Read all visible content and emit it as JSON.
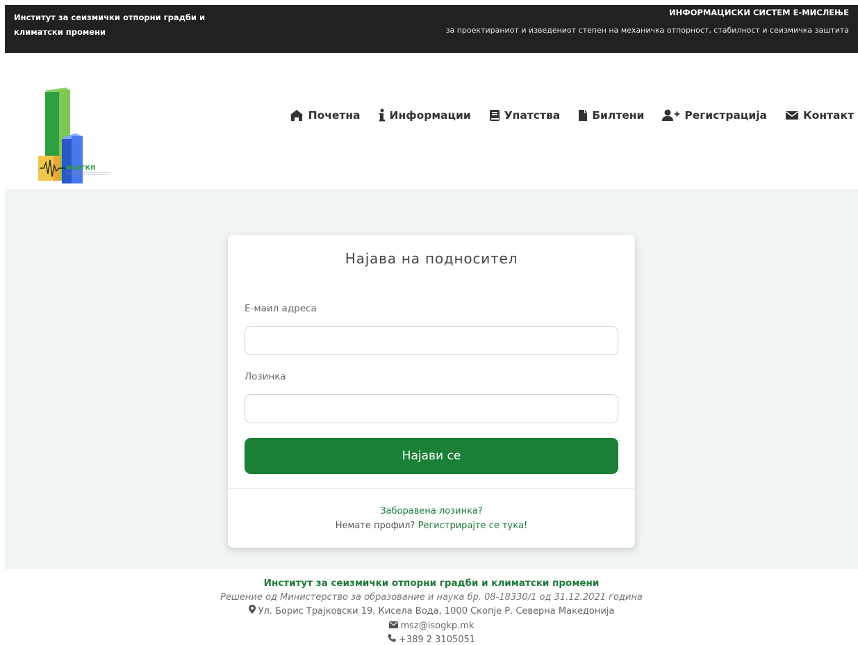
{
  "topbar": {
    "left_line1": "Институт за сеизмички отпорни градби и",
    "left_line2": "климатски промени",
    "right_title": "ИНФОРМАЦИСКИ СИСТЕМ Е-МИСЛЕЊЕ",
    "right_subtitle": "за проектираниот и изведениот степен на механичка отпорност, стабилност и сеизмичка заштита"
  },
  "logo": {
    "text": "исогкп"
  },
  "nav": {
    "items": [
      {
        "label": "Почетна",
        "icon": "home-icon"
      },
      {
        "label": "Информации",
        "icon": "info-icon"
      },
      {
        "label": "Упатства",
        "icon": "book-icon"
      },
      {
        "label": "Билтени",
        "icon": "file-icon"
      },
      {
        "label": "Регистрација",
        "icon": "user-plus-icon"
      },
      {
        "label": "Контакт",
        "icon": "envelope-icon"
      }
    ]
  },
  "login": {
    "title": "Најава на подносител",
    "email_label": "Е-маил адреса",
    "email_value": "",
    "password_label": "Лозинка",
    "password_value": "",
    "submit_label": "Најави се",
    "forgot_link": "Заборавена лозинка?",
    "no_profile_text": "Немате профил?",
    "register_link": "Регистрирајте се тука!"
  },
  "footer": {
    "title": "Институт за сеизмички отпорни градби и климатски промени",
    "decision": "Решение од Министерство за образование и наука бр. 08-18330/1 од 31.12.2021 година",
    "address": "Ул. Борис Трајковски 19, Кисела Вода, 1000 Скопје Р. Северна Македонија",
    "email": "msz@isogkp.mk",
    "phone": "+389 2 3105051"
  },
  "colors": {
    "topbar_bg": "#212121",
    "accent_green": "#198036",
    "page_bg": "#f1f5f2"
  }
}
